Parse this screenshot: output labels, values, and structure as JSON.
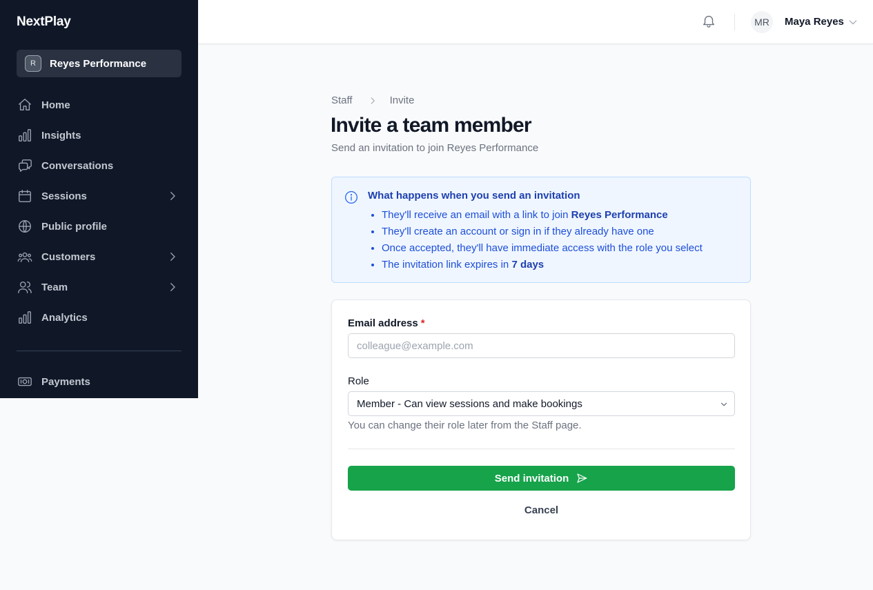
{
  "app": {
    "brand": "NextPlay"
  },
  "org": {
    "badge": "R",
    "name": "Reyes Performance"
  },
  "sidebar": {
    "items": [
      {
        "label": "Home",
        "icon": "home-icon"
      },
      {
        "label": "Insights",
        "icon": "bar-chart-icon"
      },
      {
        "label": "Conversations",
        "icon": "chat-icon"
      },
      {
        "label": "Sessions",
        "icon": "calendar-icon",
        "expandable": true
      },
      {
        "label": "Public profile",
        "icon": "globe-icon"
      },
      {
        "label": "Customers",
        "icon": "users-icon",
        "expandable": true
      },
      {
        "label": "Team",
        "icon": "team-icon",
        "expandable": true
      },
      {
        "label": "Analytics",
        "icon": "bar-chart-icon"
      }
    ],
    "bottom_items": [
      {
        "label": "Payments",
        "icon": "banknote-icon"
      }
    ]
  },
  "header": {
    "avatar_initials": "MR",
    "user_name": "Maya Reyes",
    "notification_icon": "bell-icon"
  },
  "breadcrumb": {
    "parent": "Staff",
    "current": "Invite"
  },
  "page": {
    "title": "Invite a team member",
    "subtitle": "Send an invitation to join Reyes Performance"
  },
  "info": {
    "title": "What happens when you send an invitation",
    "item1_prefix": "They'll receive an email with a link to join ",
    "item1_bold": "Reyes Performance",
    "item2": "They'll create an account or sign in if they already have one",
    "item3": "Once accepted, they'll have immediate access with the role you select",
    "item4_prefix": "The invitation link expires in ",
    "item4_bold": "7 days"
  },
  "form": {
    "email_label": "Email address",
    "required_mark": "*",
    "email_value": "",
    "email_placeholder": "colleague@example.com",
    "role_label": "Role",
    "role_selected": "Member - Can view sessions and make bookings",
    "role_help": "You can change their role later from the Staff page.",
    "send_label": "Send invitation",
    "cancel_label": "Cancel"
  },
  "colors": {
    "sidebar_bg": "#101828",
    "primary_button": "#16a34a",
    "info_bg": "#eff6ff",
    "info_text": "#1d4ed8",
    "required": "#dc2626"
  }
}
